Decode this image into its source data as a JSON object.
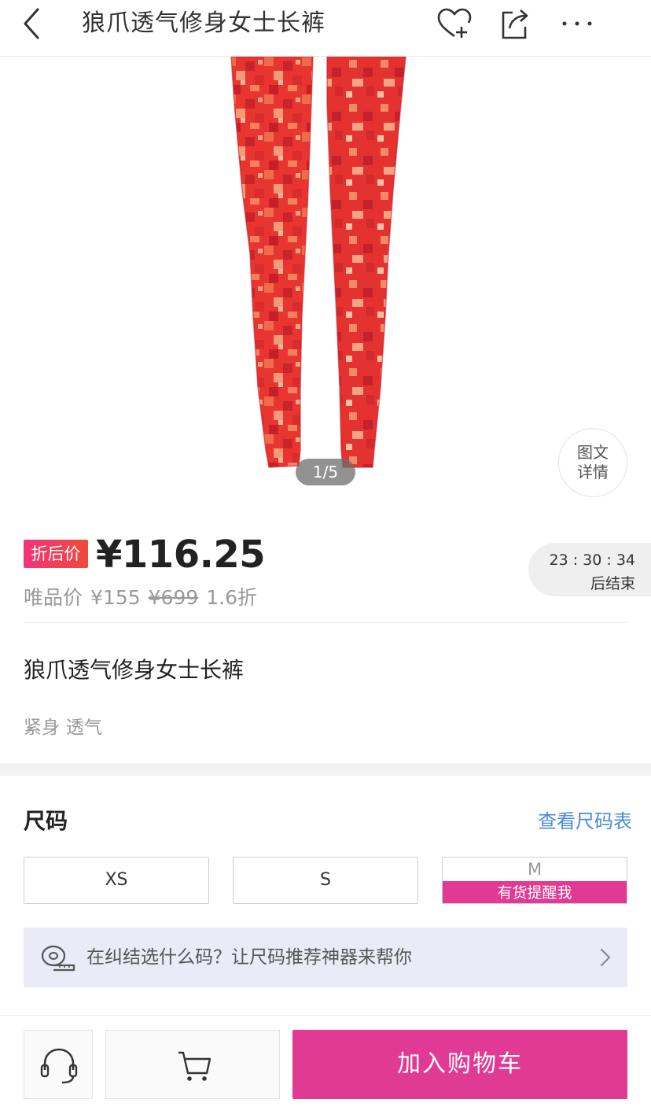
{
  "header": {
    "title": "狼爪透气修身女士长裤",
    "icons": [
      "back-arrow-icon",
      "heart-plus-icon",
      "share-icon",
      "more-icon"
    ]
  },
  "gallery": {
    "page_indicator": "1/5",
    "detail_button_line1": "图文",
    "detail_button_line2": "详情"
  },
  "price": {
    "tag": "折后价",
    "current": "¥116.25",
    "vip_label": "唯品价",
    "vip_price": "¥155",
    "original_price": "¥699",
    "discount": "1.6折",
    "countdown_time": "23 : 30 : 34",
    "countdown_suffix": "后结束"
  },
  "product": {
    "name": "狼爪透气修身女士长裤",
    "tags": [
      "紧身",
      "透气"
    ]
  },
  "size": {
    "title": "尺码",
    "chart_link": "查看尺码表",
    "options": [
      {
        "label": "XS"
      },
      {
        "label": "S"
      },
      {
        "label": "M",
        "remind": "有货提醒我"
      }
    ],
    "recommend_text": "在纠结选什么码？让尺码推荐神器来帮你"
  },
  "bottom_bar": {
    "add_to_cart": "加入购物车"
  },
  "colors": {
    "accent": "#e03a94",
    "link": "#4a8ad8",
    "legging_red": "#e8352f"
  }
}
